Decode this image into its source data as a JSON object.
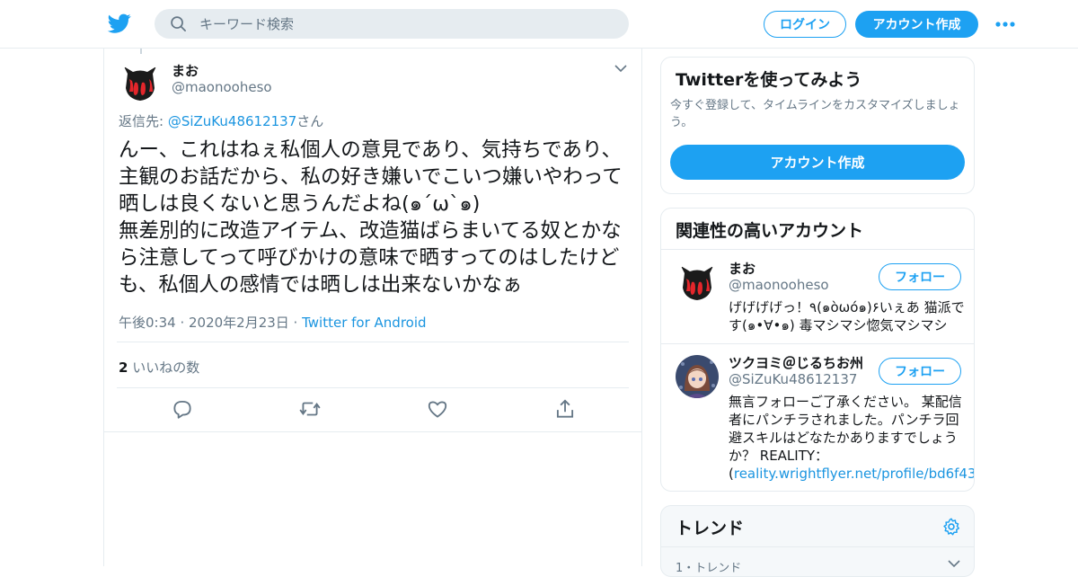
{
  "header": {
    "search_placeholder": "キーワード検索",
    "login_label": "ログイン",
    "signup_label": "アカウント作成",
    "brand_color": "#1da1f2"
  },
  "tweet": {
    "author_name": "まお",
    "author_handle": "@maonooheso",
    "reply_prefix": "返信先: ",
    "reply_handle": "@SiZuKu48612137",
    "reply_suffix": "さん",
    "text": "んー、これはねぇ私個人の意見であり、気持ちであり、主観のお話だから、私の好き嫌いでこいつ嫌いやわって晒しは良くないと思うんだよね(๑´ω`๑)\n無差別的に改造アイテム、改造猫ばらまいてる奴とかなら注意してって呼びかけの意味で晒すってのはしたけども、私個人の感情では晒しは出来ないかなぁ",
    "timestamp": "午後0:34 · 2020年2月23日 · ",
    "source": "Twitter for Android",
    "like_count": "2",
    "like_label": " いいねの数"
  },
  "sidebar": {
    "signup_card": {
      "title": "Twitterを使ってみよう",
      "description": "今すぐ登録して、タイムラインをカスタマイズしましょう。",
      "button": "アカウント作成"
    },
    "related": {
      "title": "関連性の高いアカウント",
      "accounts": [
        {
          "name": "まお",
          "handle": "@maonooheso",
          "follow": "フォロー",
          "bio": "げげげげっ！٩(๑òωó๑)۶いぇあ 猫派です(๑•∀•๑) 毒マシマシ惚気マシマシ"
        },
        {
          "name": "ツクヨミ＠じるちお州",
          "handle": "@SiZuKu48612137",
          "follow": "フォロー",
          "bio": "無言フォローご了承ください。 某配信者にパンチラされました。パンチラ回避スキルはどなたかありますでしょうか？ REALITY：(",
          "bio_link": "reality.wrightflyer.net/profile/bd6f43…",
          "bio_end": ")"
        }
      ]
    },
    "trends": {
      "title": "トレンド",
      "first_item": "1・トレンド"
    }
  }
}
